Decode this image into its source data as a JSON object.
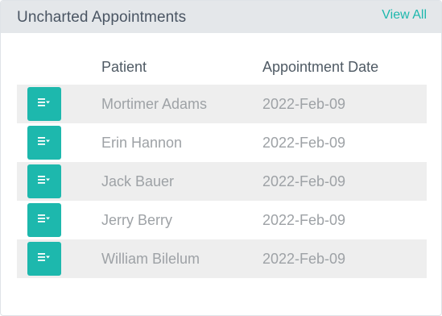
{
  "widget": {
    "title": "Uncharted Appointments",
    "view_all": "View All",
    "accent_color": "#1db8ad",
    "header_bg": "#e4e7ea"
  },
  "table": {
    "columns": [
      "Patient",
      "Appointment Date"
    ],
    "row_action_icon": "chart-note-icon",
    "rows": [
      {
        "patient": "Mortimer Adams",
        "date": "2022-Feb-09"
      },
      {
        "patient": "Erin Hannon",
        "date": "2022-Feb-09"
      },
      {
        "patient": "Jack Bauer",
        "date": "2022-Feb-09"
      },
      {
        "patient": "Jerry Berry",
        "date": "2022-Feb-09"
      },
      {
        "patient": "William Bilelum",
        "date": "2022-Feb-09"
      }
    ]
  }
}
